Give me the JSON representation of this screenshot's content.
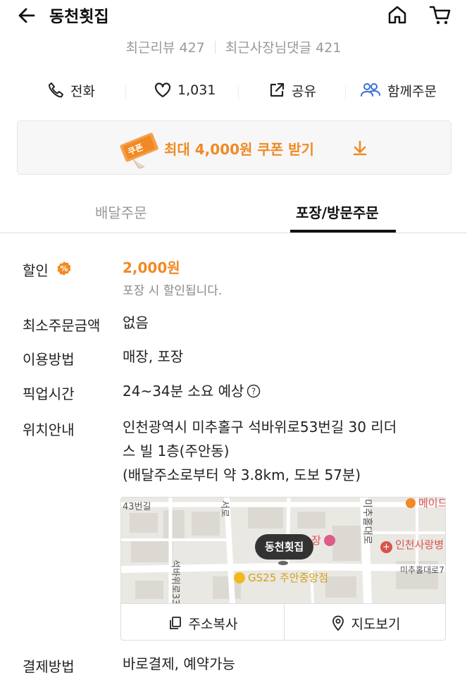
{
  "header": {
    "title": "동천횟집",
    "review_label": "최근리뷰 427",
    "owner_reply_label": "최근사장님댓글 421"
  },
  "actions": {
    "call": "전화",
    "likes": "1,031",
    "share": "공유",
    "group_order": "함께주문"
  },
  "coupon": {
    "badge": "쿠폰",
    "text": "최대 4,000원 쿠폰 받기"
  },
  "tabs": {
    "delivery": "배달주문",
    "pickup": "포장/방문주문"
  },
  "info": {
    "discount_label": "할인",
    "discount_value": "2,000원",
    "discount_note": "포장 시 할인됩니다.",
    "min_order_label": "최소주문금액",
    "min_order_value": "없음",
    "usage_label": "이용방법",
    "usage_value": "매장, 포장",
    "pickup_time_label": "픽업시간",
    "pickup_time_value": "24~34분 소요 예상",
    "location_label": "위치안내",
    "location_line1": "인천광역시 미추홀구 석바위로53번길 30 리더",
    "location_line2": "스 빌 1층(주안동)",
    "location_line3": "(배달주소로부터 약 3.8km, 도보 57분)",
    "payment_label": "결제방법",
    "payment_value": "바로결제, 예약가능"
  },
  "map": {
    "pin_label": "동천횟집",
    "street1": "43번길",
    "street2": "서로",
    "street3": "미추홀대로",
    "street4": "석바위로33",
    "street5": "미추홀대로7",
    "poi_gs": "GS25 주안중앙점",
    "poi_hospital": "인천사랑병",
    "poi_top": "메이드",
    "poi_shop": "장",
    "copy_address": "주소복사",
    "view_map": "지도보기"
  },
  "colors": {
    "accent": "#f08a24",
    "group_blue": "#3b6fd6"
  }
}
